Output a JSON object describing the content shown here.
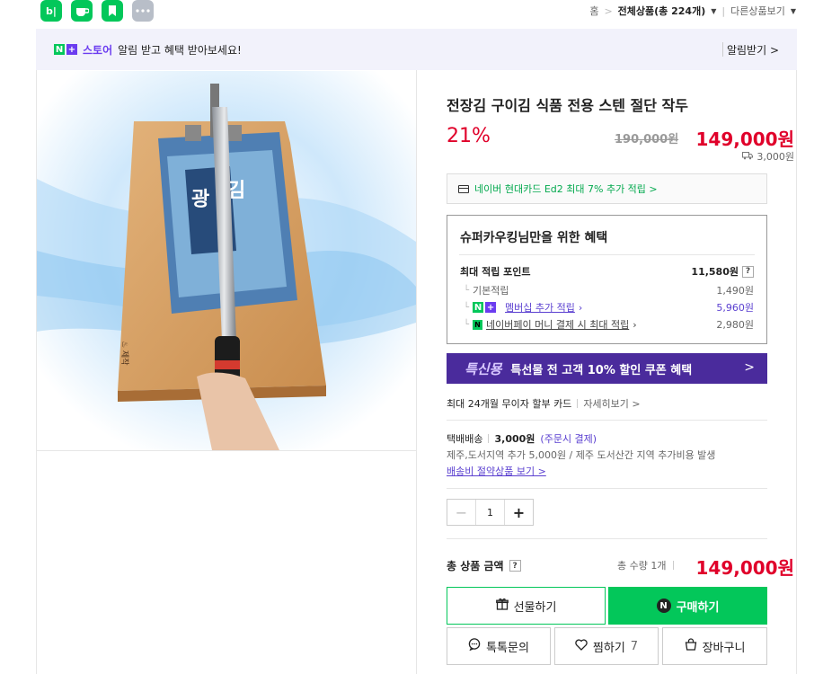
{
  "top": {
    "app_icons": [
      {
        "name": "blog-icon",
        "glyph": "b|"
      },
      {
        "name": "cafe-icon",
        "glyph": "☕"
      },
      {
        "name": "bookmark-icon",
        "glyph": "▮"
      },
      {
        "name": "more-apps-icon",
        "glyph": "•••"
      }
    ],
    "breadcrumb": {
      "home": "홈",
      "sep": ">",
      "current": "전체상품(총 224개)",
      "other": "다른상품보기"
    }
  },
  "banner": {
    "n_badge": "N",
    "plus_badge": "+",
    "store": "스토어",
    "message": "알림 받고 혜택 받아보세요!",
    "alarm": "알림받기 >"
  },
  "product": {
    "title": "전장김 구이김 식품 전용 스텐 절단 작두",
    "discount": "21%",
    "original_price": "190,000원",
    "sale_price": "149,000원",
    "shipping_fee_mini": "3,000원"
  },
  "card_promo": "네이버 현대카드 Ed2 최대 7% 추가 적립 >",
  "benefit": {
    "title": "슈퍼카우킹님만을 위한 혜택",
    "max_points_label": "최대 적립 포인트",
    "max_points_value": "11,580원",
    "help": "?",
    "basic_label": "기본적립",
    "basic_value": "1,490원",
    "membership_label": "멤버십 추가 적립",
    "membership_value": "5,960원",
    "npay_label": "네이버페이 머니 결제 시 최대 적립",
    "npay_value": "2,980원"
  },
  "promo": {
    "logo": "특신묭",
    "text": "특선물 전 고객 10% 할인 쿠폰 혜택",
    "chevron": ">"
  },
  "installment": {
    "text": "최대 24개월 무이자 할부 카드",
    "more": "자세히보기 >"
  },
  "delivery": {
    "type": "택배배송",
    "fee": "3,000원",
    "condition": "(주문시 결제)",
    "extra": "제주,도서지역 추가 5,000원 / 제주 도서산간 지역 추가비용 발생",
    "saving_link": "배송비 절약상품 보기 >"
  },
  "quantity": {
    "minus": "−",
    "value": "1",
    "plus": "+"
  },
  "total": {
    "label": "총 상품 금액",
    "help": "?",
    "qty": "총 수량 1개",
    "price": "149,000원"
  },
  "buttons": {
    "gift": "선물하기",
    "buy": "구매하기",
    "buy_badge": "N",
    "chat": "톡톡문의",
    "zzim": "찜하기",
    "zzim_count": "7",
    "cart": "장바구니"
  },
  "colors": {
    "naver_green": "#03c75a",
    "price_red": "#e0002a",
    "purple": "#5a3fd0",
    "promo_bg": "#4a2b9c"
  }
}
